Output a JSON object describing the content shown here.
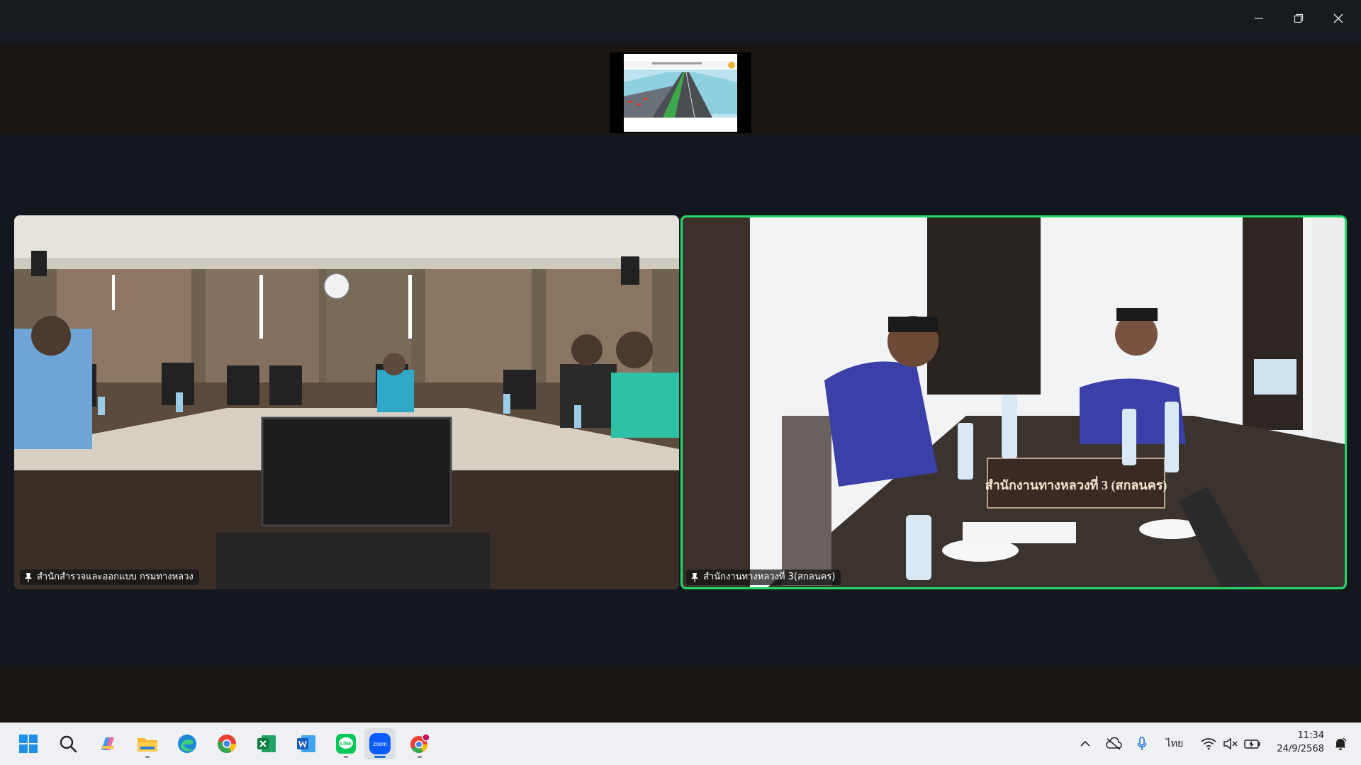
{
  "window": {
    "app": "Zoom",
    "controls": {
      "minimize": "minimize",
      "restore": "restore",
      "close": "close"
    }
  },
  "share": {
    "thumbnail_icon": "presentation-slide-thumbnail"
  },
  "participants": [
    {
      "name": "สำนักสำรวจและออกแบบ กรมทางหลวง",
      "pinned": true,
      "active_speaker": false
    },
    {
      "name": "สำนักงานทางหลวงที่ 3(สกลนคร)",
      "pinned": true,
      "active_speaker": true
    }
  ],
  "scene_text": {
    "nameplate": "สำนักงานทางหลวงที่ 3 (สกลนคร)"
  },
  "colors": {
    "active_speaker_border": "#23d96b",
    "background": "#141a1f"
  },
  "taskbar": {
    "apps": [
      {
        "icon": "windows-start-icon",
        "active": false
      },
      {
        "icon": "search-icon",
        "active": false
      },
      {
        "icon": "copilot-icon",
        "active": false
      },
      {
        "icon": "file-explorer-icon",
        "active": false
      },
      {
        "icon": "edge-icon",
        "active": false
      },
      {
        "icon": "chrome-icon",
        "active": false
      },
      {
        "icon": "excel-icon",
        "active": false
      },
      {
        "icon": "word-icon",
        "active": false
      },
      {
        "icon": "line-icon",
        "active": false,
        "label": "LINE"
      },
      {
        "icon": "zoom-icon",
        "active": true,
        "label": "zoom"
      },
      {
        "icon": "chrome-profile-icon",
        "active": false
      }
    ],
    "tray": {
      "language": "ไทย",
      "time": "11:34",
      "date": "24/9/2568"
    }
  }
}
